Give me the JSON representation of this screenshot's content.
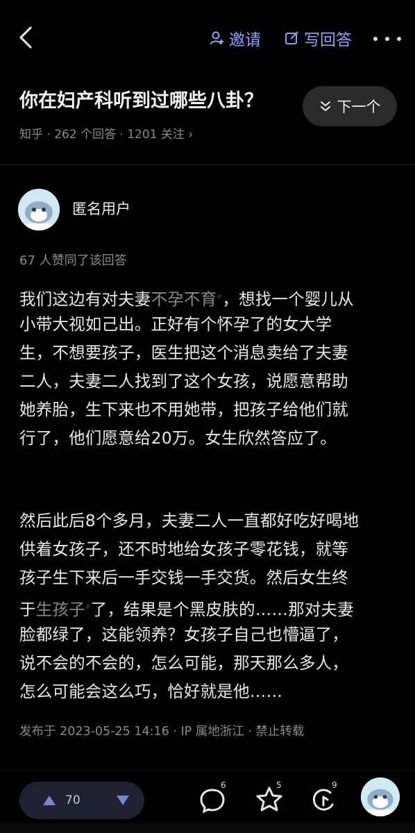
{
  "header": {
    "invite_label": "邀请",
    "write_label": "写回答"
  },
  "question": {
    "title": "你在妇产科听到过哪些八卦？",
    "next_label": "下一个",
    "meta": "知乎 · 262 个回答 · 1201 关注 ›"
  },
  "answer": {
    "author": "匿名用户",
    "likes_text": "67 人赞同了该回答",
    "para1": {
      "l1_a": "我们这边有对夫妻",
      "l1_kw": "不孕不育",
      "l1_b": "，想找一个婴儿从",
      "l2": "小带大视如己出。正好有个怀孕了的女大学",
      "l3": "生，不想要孩子，医生把这个消息卖给了夫妻",
      "l4": "二人，夫妻二人找到了这个女孩，说愿意帮助",
      "l5": "她养胎，生下来也不用她带，把孩子给他们就",
      "l6": "行了，他们愿意给20万。女生欣然答应了。"
    },
    "para2": {
      "l1": "然后此后8个多月，夫妻二人一直都好吃好喝地",
      "l2": "供着女孩子，还不时地给女孩子零花钱，就等",
      "l3": "孩子生下来后一手交钱一手交货。然后女生终",
      "l4_a": "于",
      "l4_kw": "生孩子",
      "l4_b": "了，结果是个黑皮肤的……那对夫妻",
      "l5": "脸都绿了，这能领养？女孩子自己也懵逼了，",
      "l6": "说不会的不会的，怎么可能，那天那么多人，",
      "l7": "怎么可能会这么巧，恰好就是他……"
    },
    "published": "发布于 2023-05-25 14:16 · IP 属地浙江 · 禁止转载"
  },
  "actions": {
    "vote_count": "70",
    "comment_count": "6",
    "favorite_count": "5",
    "like_count": "9"
  },
  "colors": {
    "accent": "#8ea1ff",
    "background": "#000000",
    "muted": "#8a8a8a"
  }
}
